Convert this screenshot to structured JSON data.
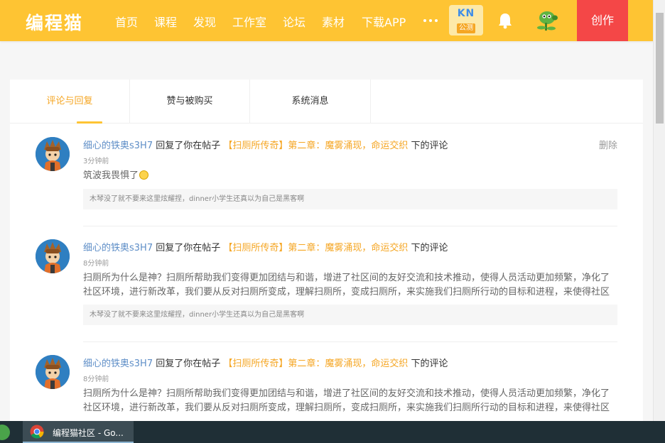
{
  "topnav": {
    "logo": "编程猫",
    "items": [
      {
        "label": "首页"
      },
      {
        "label": "课程"
      },
      {
        "label": "发现"
      },
      {
        "label": "工作室"
      },
      {
        "label": "论坛"
      },
      {
        "label": "素材"
      },
      {
        "label": "下载APP"
      }
    ],
    "kn_badge": {
      "top": "KN",
      "bottom": "公测"
    },
    "create_label": "创作",
    "colors": {
      "bar": "#fec433",
      "create": "#f44747"
    }
  },
  "tabs": [
    {
      "label": "评论与回复",
      "active": true
    },
    {
      "label": "赞与被购买",
      "active": false
    },
    {
      "label": "系统消息",
      "active": false
    }
  ],
  "messages": [
    {
      "user": "细心的铁奥s3H7",
      "action": "回复了你在帖子",
      "post_title": "【扫厕所传奇】第二章：魔雾涌现，命运交织",
      "suffix": "下的评论",
      "time": "3分钟前",
      "content": "筑波我畏惧了",
      "quote": "木琴没了就不要来这里炫耀捏，dinner小学生还真以为自己是黑客啊",
      "delete_label": "删除"
    },
    {
      "user": "细心的铁奥s3H7",
      "action": "回复了你在帖子",
      "post_title": "【扫厕所传奇】第二章：魔雾涌现，命运交织",
      "suffix": "下的评论",
      "time": "8分钟前",
      "content": "扫厕所为什么是神？扫厕所帮助我们变得更加团结与和谐，增进了社区间的友好交流和技术推动，使得人员活动更加频繁，净化了社区环境，进行新改革，我们要从反对扫厕所变成，理解扫厕所，变成扫厕所，来实施我们扫厕所行动的目标和进程，来使得社区更加美...",
      "quote": "木琴没了就不要来这里炫耀捏，dinner小学生还真以为自己是黑客啊"
    },
    {
      "user": "细心的铁奥s3H7",
      "action": "回复了你在帖子",
      "post_title": "【扫厕所传奇】第二章：魔雾涌现，命运交织",
      "suffix": "下的评论",
      "time": "8分钟前",
      "content": "扫厕所为什么是神？扫厕所帮助我们变得更加团结与和谐，增进了社区间的友好交流和技术推动，使得人员活动更加频繁，净化了社区环境，进行新改革，我们要从反对扫厕所变成，理解扫厕所，变成扫厕所，来实施我们扫厕所行动的目标和进程，来使得社区更加美..."
    }
  ],
  "taskbar": {
    "app_label": "编程猫社区 - Go..."
  }
}
